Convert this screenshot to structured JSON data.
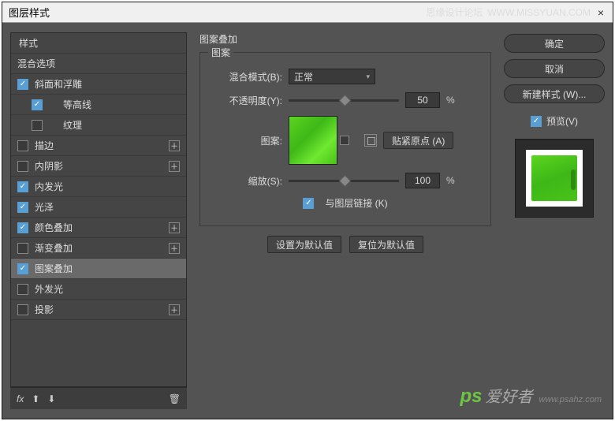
{
  "titlebar": {
    "title": "图层样式",
    "forum": "思缘设计论坛",
    "url": "WWW.MISSYUAN.COM"
  },
  "left": {
    "header": "样式",
    "blend": "混合选项",
    "items": [
      {
        "checked": true,
        "label": "斜面和浮雕",
        "plus": false,
        "indent": false
      },
      {
        "checked": true,
        "label": "等高线",
        "plus": false,
        "indent": true
      },
      {
        "checked": false,
        "label": "纹理",
        "plus": false,
        "indent": true
      },
      {
        "checked": false,
        "label": "描边",
        "plus": true,
        "indent": false
      },
      {
        "checked": false,
        "label": "内阴影",
        "plus": true,
        "indent": false
      },
      {
        "checked": true,
        "label": "内发光",
        "plus": false,
        "indent": false
      },
      {
        "checked": true,
        "label": "光泽",
        "plus": false,
        "indent": false
      },
      {
        "checked": true,
        "label": "颜色叠加",
        "plus": true,
        "indent": false
      },
      {
        "checked": false,
        "label": "渐变叠加",
        "plus": true,
        "indent": false
      },
      {
        "checked": true,
        "label": "图案叠加",
        "plus": false,
        "indent": false,
        "selected": true
      },
      {
        "checked": false,
        "label": "外发光",
        "plus": false,
        "indent": false
      },
      {
        "checked": false,
        "label": "投影",
        "plus": true,
        "indent": false
      }
    ],
    "fx": "fx"
  },
  "mid": {
    "groupTitle": "图案叠加",
    "legend": "图案",
    "blendModeLabel": "混合模式(B):",
    "blendModeValue": "正常",
    "opacityLabel": "不透明度(Y):",
    "opacityValue": "50",
    "percent": "%",
    "patternLabel": "图案:",
    "snapLabel": "贴紧原点 (A)",
    "scaleLabel": "缩放(S):",
    "scaleValue": "100",
    "linkLabel": "与图层链接 (K)",
    "setDefault": "设置为默认值",
    "resetDefault": "复位为默认值"
  },
  "right": {
    "ok": "确定",
    "cancel": "取消",
    "newStyle": "新建样式 (W)...",
    "preview": "预览(V)"
  },
  "watermark": {
    "ps": "ps",
    "cn": "爱好者",
    "url": "www.psahz.com"
  }
}
